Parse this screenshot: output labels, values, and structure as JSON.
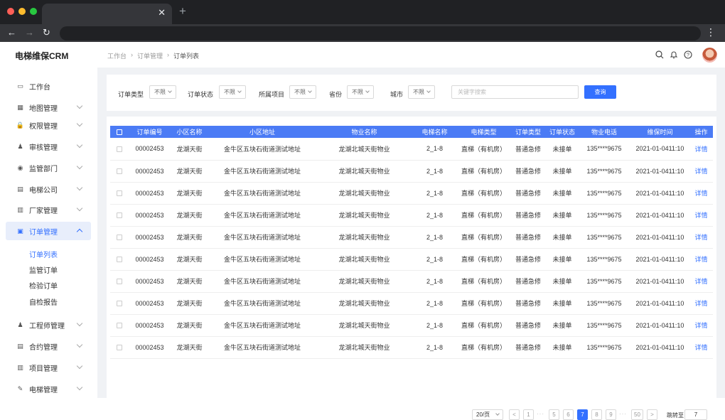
{
  "app": {
    "title": "电梯维保CRM"
  },
  "breadcrumb": [
    "工作台",
    "订单管理",
    "订单列表"
  ],
  "sidebar": {
    "items": [
      {
        "label": "工作台",
        "icon": "monitor-icon",
        "chevron": false
      },
      {
        "label": "地图管理",
        "icon": "map-icon",
        "chevron": true
      },
      {
        "label": "权限管理",
        "icon": "lock-icon",
        "chevron": true
      },
      {
        "label": "审核管理",
        "icon": "stamp-icon",
        "chevron": true
      },
      {
        "label": "监管部门",
        "icon": "badge-icon",
        "chevron": true
      },
      {
        "label": "电梯公司",
        "icon": "building-icon",
        "chevron": true
      },
      {
        "label": "厂家管理",
        "icon": "factory-icon",
        "chevron": true
      },
      {
        "label": "订单管理",
        "icon": "order-icon",
        "chevron": true,
        "active": true
      },
      {
        "label": "工程师管理",
        "icon": "engineer-icon",
        "chevron": true
      },
      {
        "label": "合约管理",
        "icon": "contract-icon",
        "chevron": true
      },
      {
        "label": "项目管理",
        "icon": "project-icon",
        "chevron": true
      },
      {
        "label": "电梯管理",
        "icon": "wrench-icon",
        "chevron": true
      }
    ],
    "sub_items": [
      "订单列表",
      "监管订单",
      "检验订单",
      "自检报告"
    ]
  },
  "filters": {
    "fields": [
      {
        "label": "订单类型",
        "value": "不限"
      },
      {
        "label": "订单状态",
        "value": "不限"
      },
      {
        "label": "所属项目",
        "value": "不限"
      },
      {
        "label": "省份",
        "value": "不限"
      },
      {
        "label": "城市",
        "value": "不限"
      }
    ],
    "search_placeholder": "关键字搜索",
    "query_label": "查询"
  },
  "table": {
    "columns": [
      "订单编号",
      "小区名称",
      "小区地址",
      "物业名称",
      "电梯名称",
      "电梯类型",
      "订单类型",
      "订单状态",
      "物业电话",
      "维保时间",
      "操作"
    ],
    "rows": [
      [
        "00002453",
        "龙湖天街",
        "金牛区五块石街道测试地址",
        "龙湖北城天街物业",
        "2_1-8",
        "直梯（有机房）",
        "普通急修",
        "未接单",
        "135****9675",
        "2021-01-0411:10",
        "详情"
      ],
      [
        "00002453",
        "龙湖天街",
        "金牛区五块石街道测试地址",
        "龙湖北城天街物业",
        "2_1-8",
        "直梯（有机房）",
        "普通急修",
        "未接单",
        "135****9675",
        "2021-01-0411:10",
        "详情"
      ],
      [
        "00002453",
        "龙湖天街",
        "金牛区五块石街道测试地址",
        "龙湖北城天街物业",
        "2_1-8",
        "直梯（有机房）",
        "普通急修",
        "未接单",
        "135****9675",
        "2021-01-0411:10",
        "详情"
      ],
      [
        "00002453",
        "龙湖天街",
        "金牛区五块石街道测试地址",
        "龙湖北城天街物业",
        "2_1-8",
        "直梯（有机房）",
        "普通急修",
        "未接单",
        "135****9675",
        "2021-01-0411:10",
        "详情"
      ],
      [
        "00002453",
        "龙湖天街",
        "金牛区五块石街道测试地址",
        "龙湖北城天街物业",
        "2_1-8",
        "直梯（有机房）",
        "普通急修",
        "未接单",
        "135****9675",
        "2021-01-0411:10",
        "详情"
      ],
      [
        "00002453",
        "龙湖天街",
        "金牛区五块石街道测试地址",
        "龙湖北城天街物业",
        "2_1-8",
        "直梯（有机房）",
        "普通急修",
        "未接单",
        "135****9675",
        "2021-01-0411:10",
        "详情"
      ],
      [
        "00002453",
        "龙湖天街",
        "金牛区五块石街道测试地址",
        "龙湖北城天街物业",
        "2_1-8",
        "直梯（有机房）",
        "普通急修",
        "未接单",
        "135****9675",
        "2021-01-0411:10",
        "详情"
      ],
      [
        "00002453",
        "龙湖天街",
        "金牛区五块石街道测试地址",
        "龙湖北城天街物业",
        "2_1-8",
        "直梯（有机房）",
        "普通急修",
        "未接单",
        "135****9675",
        "2021-01-0411:10",
        "详情"
      ],
      [
        "00002453",
        "龙湖天街",
        "金牛区五块石街道测试地址",
        "龙湖北城天街物业",
        "2_1-8",
        "直梯（有机房）",
        "普通急修",
        "未接单",
        "135****9675",
        "2021-01-0411:10",
        "详情"
      ],
      [
        "00002453",
        "龙湖天街",
        "金牛区五块石街道测试地址",
        "龙湖北城天街物业",
        "2_1-8",
        "直梯（有机房）",
        "普通急修",
        "未接单",
        "135****9675",
        "2021-01-0411:10",
        "详情"
      ]
    ]
  },
  "pagination": {
    "page_size": "20/页",
    "prev": "<",
    "next": ">",
    "pages": [
      "1",
      "5",
      "6",
      "7",
      "8",
      "9",
      "50"
    ],
    "current": "7",
    "ellipsis": "···",
    "jump_label": "跳转至",
    "jump_value": "7"
  },
  "colors": {
    "accent": "#3370ff",
    "table_header": "#4b7bf5"
  }
}
